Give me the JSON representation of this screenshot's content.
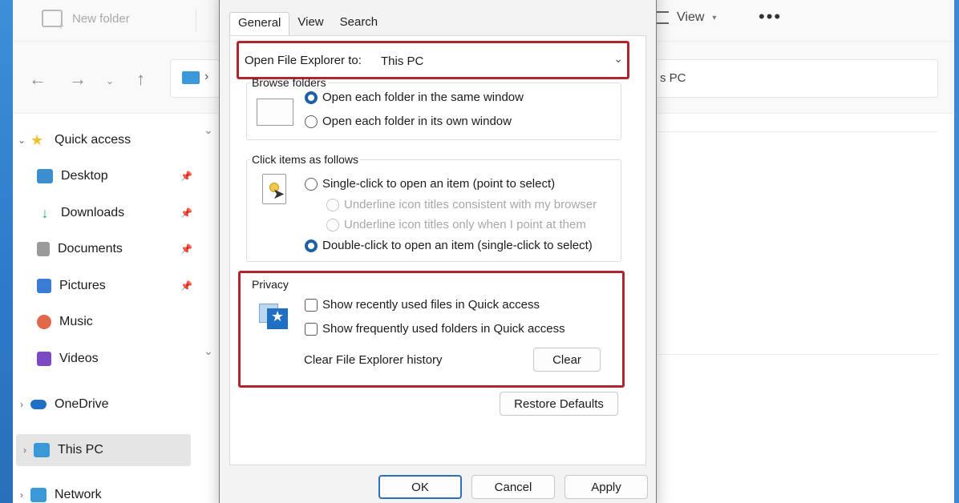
{
  "explorer": {
    "new_folder_label": "New folder",
    "view_label": "View",
    "more_label": "•••",
    "address_fragment": "s PC",
    "sidebar": [
      {
        "label": "Quick access",
        "color": "#f2c028"
      },
      {
        "label": "Desktop",
        "color": "#3b8ed0"
      },
      {
        "label": "Downloads",
        "color": "#2e9e6b"
      },
      {
        "label": "Documents",
        "color": "#8a8a8a"
      },
      {
        "label": "Pictures",
        "color": "#3a7bd5"
      },
      {
        "label": "Music",
        "color": "#e2684a"
      },
      {
        "label": "Videos",
        "color": "#7b4bc4"
      },
      {
        "label": "OneDrive",
        "color": "#1f6fc4"
      },
      {
        "label": "This PC",
        "color": "#3a9ad9"
      },
      {
        "label": "Network",
        "color": "#3a9ad9"
      }
    ]
  },
  "dialog": {
    "tabs": [
      "General",
      "View",
      "Search"
    ],
    "open_label": "Open File Explorer to:",
    "open_value": "This PC",
    "browse": {
      "legend": "Browse folders",
      "option1": "Open each folder in the same window",
      "option2": "Open each folder in its own window"
    },
    "click": {
      "legend": "Click items as follows",
      "single": "Single-click to open an item (point to select)",
      "underline1": "Underline icon titles consistent with my browser",
      "underline2": "Underline icon titles only when I point at them",
      "double": "Double-click to open an item (single-click to select)"
    },
    "privacy": {
      "legend": "Privacy",
      "recent_files": "Show recently used files in Quick access",
      "frequent_folders": "Show frequently used folders in Quick access",
      "clear_label": "Clear File Explorer history",
      "clear_button": "Clear"
    },
    "restore_defaults": "Restore Defaults",
    "ok": "OK",
    "cancel": "Cancel",
    "apply": "Apply",
    "highlight_color": "#b1262e"
  }
}
